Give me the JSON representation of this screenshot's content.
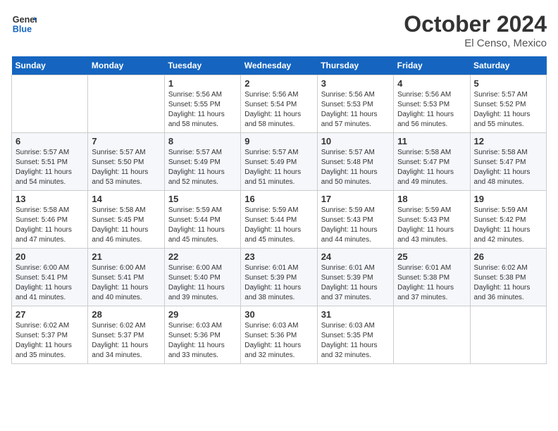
{
  "header": {
    "logo_line1": "General",
    "logo_line2": "Blue",
    "month": "October 2024",
    "location": "El Censo, Mexico"
  },
  "days_of_week": [
    "Sunday",
    "Monday",
    "Tuesday",
    "Wednesday",
    "Thursday",
    "Friday",
    "Saturday"
  ],
  "weeks": [
    [
      {
        "day": "",
        "info": ""
      },
      {
        "day": "",
        "info": ""
      },
      {
        "day": "1",
        "info": "Sunrise: 5:56 AM\nSunset: 5:55 PM\nDaylight: 11 hours and 58 minutes."
      },
      {
        "day": "2",
        "info": "Sunrise: 5:56 AM\nSunset: 5:54 PM\nDaylight: 11 hours and 58 minutes."
      },
      {
        "day": "3",
        "info": "Sunrise: 5:56 AM\nSunset: 5:53 PM\nDaylight: 11 hours and 57 minutes."
      },
      {
        "day": "4",
        "info": "Sunrise: 5:56 AM\nSunset: 5:53 PM\nDaylight: 11 hours and 56 minutes."
      },
      {
        "day": "5",
        "info": "Sunrise: 5:57 AM\nSunset: 5:52 PM\nDaylight: 11 hours and 55 minutes."
      }
    ],
    [
      {
        "day": "6",
        "info": "Sunrise: 5:57 AM\nSunset: 5:51 PM\nDaylight: 11 hours and 54 minutes."
      },
      {
        "day": "7",
        "info": "Sunrise: 5:57 AM\nSunset: 5:50 PM\nDaylight: 11 hours and 53 minutes."
      },
      {
        "day": "8",
        "info": "Sunrise: 5:57 AM\nSunset: 5:49 PM\nDaylight: 11 hours and 52 minutes."
      },
      {
        "day": "9",
        "info": "Sunrise: 5:57 AM\nSunset: 5:49 PM\nDaylight: 11 hours and 51 minutes."
      },
      {
        "day": "10",
        "info": "Sunrise: 5:57 AM\nSunset: 5:48 PM\nDaylight: 11 hours and 50 minutes."
      },
      {
        "day": "11",
        "info": "Sunrise: 5:58 AM\nSunset: 5:47 PM\nDaylight: 11 hours and 49 minutes."
      },
      {
        "day": "12",
        "info": "Sunrise: 5:58 AM\nSunset: 5:47 PM\nDaylight: 11 hours and 48 minutes."
      }
    ],
    [
      {
        "day": "13",
        "info": "Sunrise: 5:58 AM\nSunset: 5:46 PM\nDaylight: 11 hours and 47 minutes."
      },
      {
        "day": "14",
        "info": "Sunrise: 5:58 AM\nSunset: 5:45 PM\nDaylight: 11 hours and 46 minutes."
      },
      {
        "day": "15",
        "info": "Sunrise: 5:59 AM\nSunset: 5:44 PM\nDaylight: 11 hours and 45 minutes."
      },
      {
        "day": "16",
        "info": "Sunrise: 5:59 AM\nSunset: 5:44 PM\nDaylight: 11 hours and 45 minutes."
      },
      {
        "day": "17",
        "info": "Sunrise: 5:59 AM\nSunset: 5:43 PM\nDaylight: 11 hours and 44 minutes."
      },
      {
        "day": "18",
        "info": "Sunrise: 5:59 AM\nSunset: 5:43 PM\nDaylight: 11 hours and 43 minutes."
      },
      {
        "day": "19",
        "info": "Sunrise: 5:59 AM\nSunset: 5:42 PM\nDaylight: 11 hours and 42 minutes."
      }
    ],
    [
      {
        "day": "20",
        "info": "Sunrise: 6:00 AM\nSunset: 5:41 PM\nDaylight: 11 hours and 41 minutes."
      },
      {
        "day": "21",
        "info": "Sunrise: 6:00 AM\nSunset: 5:41 PM\nDaylight: 11 hours and 40 minutes."
      },
      {
        "day": "22",
        "info": "Sunrise: 6:00 AM\nSunset: 5:40 PM\nDaylight: 11 hours and 39 minutes."
      },
      {
        "day": "23",
        "info": "Sunrise: 6:01 AM\nSunset: 5:39 PM\nDaylight: 11 hours and 38 minutes."
      },
      {
        "day": "24",
        "info": "Sunrise: 6:01 AM\nSunset: 5:39 PM\nDaylight: 11 hours and 37 minutes."
      },
      {
        "day": "25",
        "info": "Sunrise: 6:01 AM\nSunset: 5:38 PM\nDaylight: 11 hours and 37 minutes."
      },
      {
        "day": "26",
        "info": "Sunrise: 6:02 AM\nSunset: 5:38 PM\nDaylight: 11 hours and 36 minutes."
      }
    ],
    [
      {
        "day": "27",
        "info": "Sunrise: 6:02 AM\nSunset: 5:37 PM\nDaylight: 11 hours and 35 minutes."
      },
      {
        "day": "28",
        "info": "Sunrise: 6:02 AM\nSunset: 5:37 PM\nDaylight: 11 hours and 34 minutes."
      },
      {
        "day": "29",
        "info": "Sunrise: 6:03 AM\nSunset: 5:36 PM\nDaylight: 11 hours and 33 minutes."
      },
      {
        "day": "30",
        "info": "Sunrise: 6:03 AM\nSunset: 5:36 PM\nDaylight: 11 hours and 32 minutes."
      },
      {
        "day": "31",
        "info": "Sunrise: 6:03 AM\nSunset: 5:35 PM\nDaylight: 11 hours and 32 minutes."
      },
      {
        "day": "",
        "info": ""
      },
      {
        "day": "",
        "info": ""
      }
    ]
  ]
}
